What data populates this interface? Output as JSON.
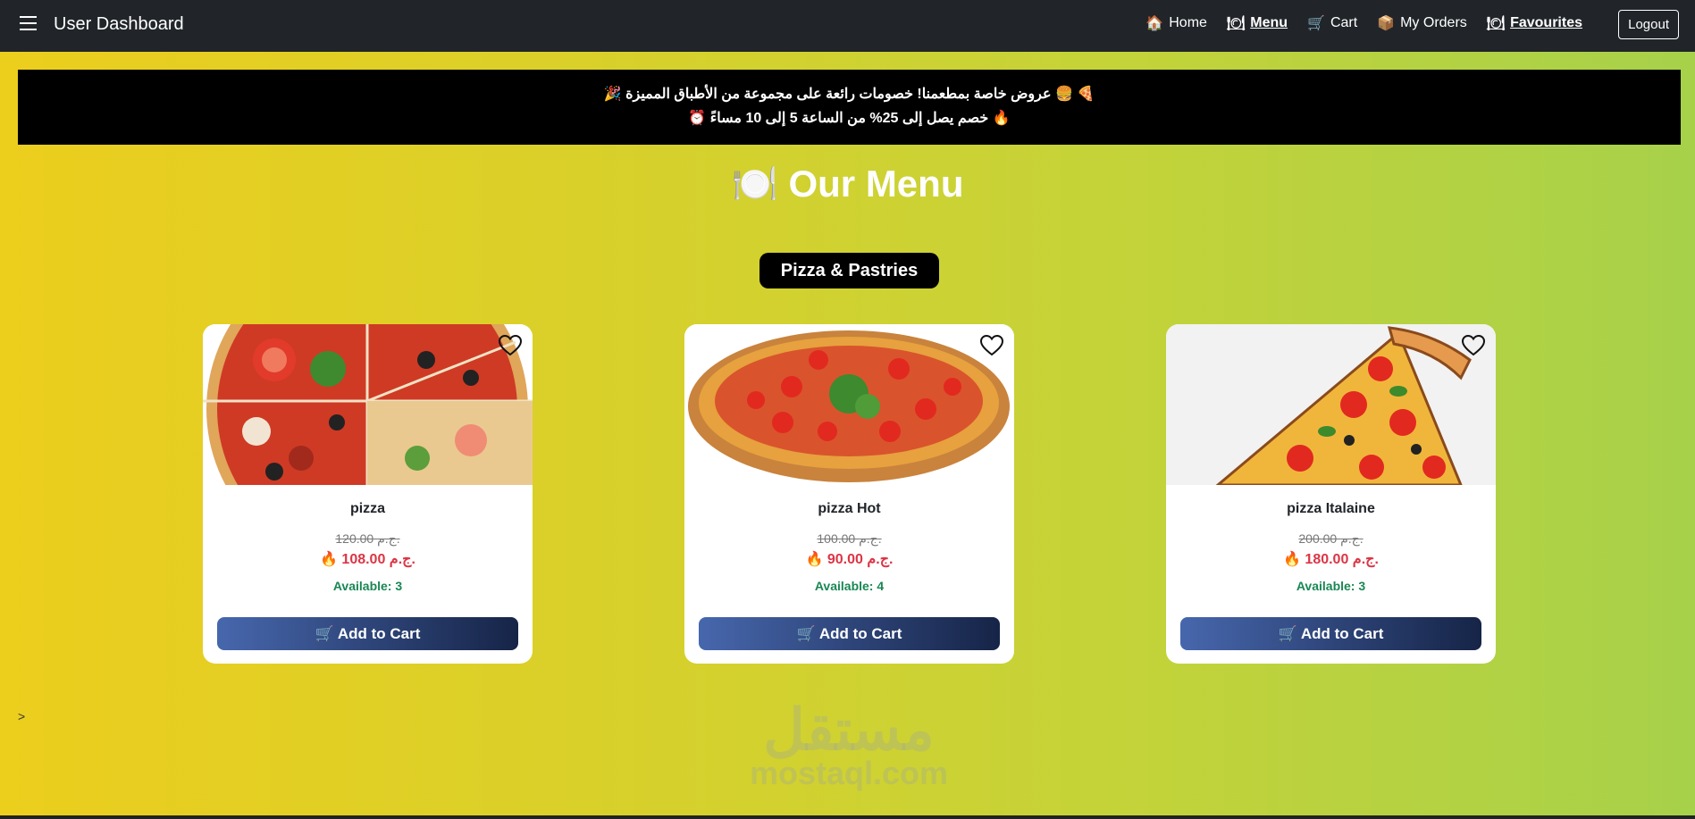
{
  "navbar": {
    "brand": "User Dashboard",
    "links": [
      {
        "label": "Home",
        "icon": "house-icon"
      },
      {
        "label": "Menu",
        "icon": "plate-icon",
        "active": true
      },
      {
        "label": "Cart",
        "icon": "cart-icon"
      },
      {
        "label": "My Orders",
        "icon": "package-icon"
      },
      {
        "label": "Favourites",
        "icon": "plate-icon",
        "active": true
      }
    ],
    "logout": "Logout"
  },
  "promo": {
    "line1": "🍕 🍔 عروض خاصة بمطعمنا! خصومات رائعة على مجموعة من الأطباق المميزة 🎉",
    "line2": "🔥 خصم يصل إلى 25% من الساعة 5 إلى 10 مساءً ⏰"
  },
  "page_title": {
    "icon": "🍽️",
    "text": "Our Menu"
  },
  "category": "Pizza & Pastries",
  "products": [
    {
      "name": "pizza",
      "old_price": "120.00 ج.م.",
      "new_price": "🔥 108.00 ج.م.",
      "available": "Available: 3",
      "button": "Add to Cart"
    },
    {
      "name": "pizza Hot",
      "old_price": "100.00 ج.م.",
      "new_price": "🔥 90.00 ج.م.",
      "available": "Available: 4",
      "button": "Add to Cart"
    },
    {
      "name": "pizza Italaine",
      "old_price": "200.00 ج.م.",
      "new_price": "🔥 180.00 ج.م.",
      "available": "Available: 3",
      "button": "Add to Cart"
    }
  ],
  "toggle_arrow": ">",
  "watermark": {
    "arabic": "مستقل",
    "latin": "mostaql.com"
  },
  "colors": {
    "navbar": "#212529",
    "price_new": "#dc3545",
    "available": "#198754",
    "button_start": "#4767ad",
    "button_end": "#162447"
  }
}
